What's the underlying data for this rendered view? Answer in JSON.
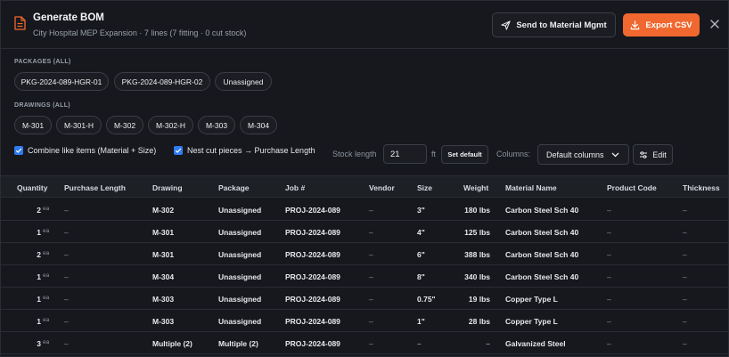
{
  "header": {
    "title": "Generate BOM",
    "subtitle": "City Hospital MEP Expansion · 7 lines (7 fitting · 0 cut stock)",
    "send_label": "Send to Material Mgmt",
    "export_label": "Export CSV"
  },
  "packages": {
    "label": "PACKAGES (ALL)",
    "chips": [
      "PKG-2024-089-HGR-01",
      "PKG-2024-089-HGR-02",
      "Unassigned"
    ]
  },
  "drawings": {
    "label": "DRAWINGS (ALL)",
    "chips": [
      "M-301",
      "M-301-H",
      "M-302",
      "M-302-H",
      "M-303",
      "M-304"
    ]
  },
  "options": {
    "combine_label": "Combine like items (Material + Size)",
    "nest_label": "Nest cut pieces → Purchase Length",
    "stock_length_label": "Stock length",
    "stock_length_value": "21",
    "stock_unit": "ft",
    "set_default_label": "Set default",
    "columns_label": "Columns:",
    "columns_value": "Default columns",
    "edit_label": "Edit"
  },
  "table": {
    "columns": [
      "Quantity",
      "Purchase Length",
      "Drawing",
      "Package",
      "Job #",
      "Vendor",
      "Size",
      "Weight",
      "Material Name",
      "Product Code",
      "Thickness"
    ],
    "unit": "ea",
    "rows": [
      {
        "qty": "2",
        "purchase": "–",
        "drawing": "M-302",
        "package": "Unassigned",
        "job": "PROJ-2024-089",
        "vendor": "–",
        "size": "3\"",
        "weight": "180 lbs",
        "material": "Carbon Steel Sch 40",
        "code": "–",
        "thickness": "–"
      },
      {
        "qty": "1",
        "purchase": "–",
        "drawing": "M-301",
        "package": "Unassigned",
        "job": "PROJ-2024-089",
        "vendor": "–",
        "size": "4\"",
        "weight": "125 lbs",
        "material": "Carbon Steel Sch 40",
        "code": "–",
        "thickness": "–"
      },
      {
        "qty": "2",
        "purchase": "–",
        "drawing": "M-301",
        "package": "Unassigned",
        "job": "PROJ-2024-089",
        "vendor": "–",
        "size": "6\"",
        "weight": "388 lbs",
        "material": "Carbon Steel Sch 40",
        "code": "–",
        "thickness": "–"
      },
      {
        "qty": "1",
        "purchase": "–",
        "drawing": "M-304",
        "package": "Unassigned",
        "job": "PROJ-2024-089",
        "vendor": "–",
        "size": "8\"",
        "weight": "340 lbs",
        "material": "Carbon Steel Sch 40",
        "code": "–",
        "thickness": "–"
      },
      {
        "qty": "1",
        "purchase": "–",
        "drawing": "M-303",
        "package": "Unassigned",
        "job": "PROJ-2024-089",
        "vendor": "–",
        "size": "0.75\"",
        "weight": "19 lbs",
        "material": "Copper Type L",
        "code": "–",
        "thickness": "–"
      },
      {
        "qty": "1",
        "purchase": "–",
        "drawing": "M-303",
        "package": "Unassigned",
        "job": "PROJ-2024-089",
        "vendor": "–",
        "size": "1\"",
        "weight": "28 lbs",
        "material": "Copper Type L",
        "code": "–",
        "thickness": "–"
      },
      {
        "qty": "3",
        "purchase": "–",
        "drawing": "Multiple (2)",
        "package": "Multiple (2)",
        "job": "PROJ-2024-089",
        "vendor": "–",
        "size": "–",
        "weight": "–",
        "material": "Galvanized Steel",
        "code": "–",
        "thickness": "–"
      }
    ]
  },
  "colors": {
    "accent": "#f0682f",
    "checkbox": "#2f7bf0",
    "background": "#16181d"
  }
}
